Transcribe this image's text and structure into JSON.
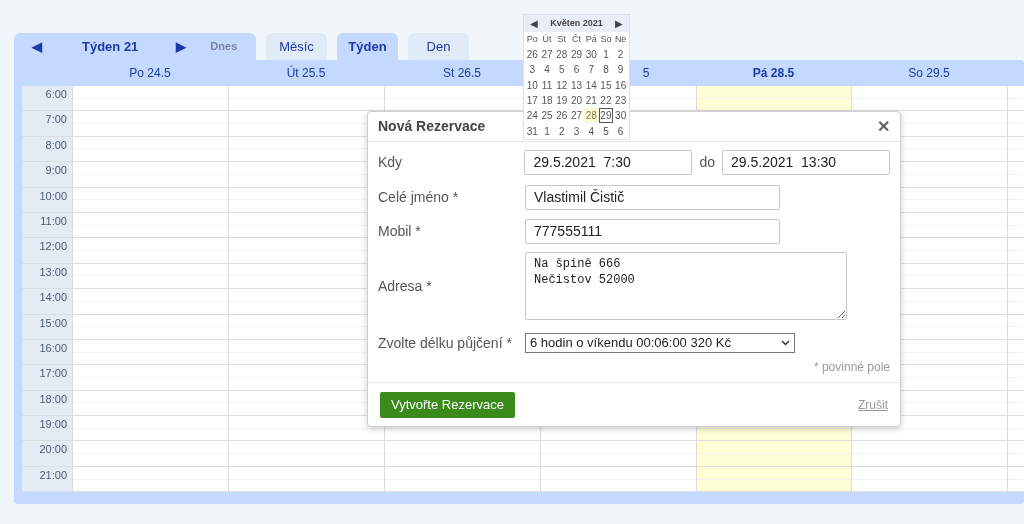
{
  "navigator": {
    "prev_arrow": "◀",
    "week_label": "Týden 21",
    "next_arrow": "▶",
    "today_button": {
      "label": "Dnes",
      "disabled": true
    }
  },
  "view_tabs": [
    {
      "label": "Měsíc",
      "selected": false
    },
    {
      "label": "Týden",
      "selected": true
    },
    {
      "label": "Den",
      "selected": false
    }
  ],
  "days": [
    {
      "label": "Po 24.5",
      "today": false
    },
    {
      "label": "Út 25.5",
      "today": false
    },
    {
      "label": "St 26.5",
      "today": false
    },
    {
      "label": "5",
      "today": false
    },
    {
      "label": "Pá 28.5",
      "today": true
    },
    {
      "label": "So 29.5",
      "today": false
    },
    {
      "today": false
    }
  ],
  "hours": [
    "6:00",
    "7:00",
    "8:00",
    "9:00",
    "10:00",
    "11:00",
    "12:00",
    "13:00",
    "14:00",
    "15:00",
    "16:00",
    "17:00",
    "18:00",
    "19:00",
    "20:00",
    "21:00"
  ],
  "dialog": {
    "title": "Nová Rezervace",
    "close": "✕",
    "when": {
      "label": "Kdy",
      "from": "29.5.2021  7:30",
      "separator": "do",
      "to": "29.5.2021  13:30"
    },
    "name": {
      "label": "Celé jméno *",
      "value": "Vlastimil Čistič"
    },
    "mobile": {
      "label": "Mobil *",
      "value": "777555111"
    },
    "address": {
      "label": "Adresa *",
      "value": "Na špině 666\nNečistov 52000"
    },
    "duration": {
      "label": "Zvolte délku půjčení *",
      "value": "6 hodin o víkendu 00:06:00 320 Kč"
    },
    "required_note": "* povinné pole",
    "submit": "Vytvořte Rezervace",
    "cancel": "Zrušit"
  },
  "mini_calendar": {
    "prev_arrow": "◀",
    "title": "Květen 2021",
    "next_arrow": "▶",
    "weekdays": [
      "Po",
      "Út",
      "St",
      "Čt",
      "Pá",
      "So",
      "Ne"
    ],
    "weeks": [
      [
        {
          "label": "26",
          "today": false,
          "selected": false
        },
        {
          "label": "27",
          "today": false,
          "selected": false
        },
        {
          "label": "28",
          "today": false,
          "selected": false
        },
        {
          "label": "29",
          "today": false,
          "selected": false
        },
        {
          "label": "30",
          "today": false,
          "selected": false
        },
        {
          "label": "1",
          "today": false,
          "selected": false
        },
        {
          "label": "2",
          "today": false,
          "selected": false
        }
      ],
      [
        {
          "label": "3",
          "today": false,
          "selected": false
        },
        {
          "label": "4",
          "today": false,
          "selected": false
        },
        {
          "label": "5",
          "today": false,
          "selected": false
        },
        {
          "label": "6",
          "today": false,
          "selected": false
        },
        {
          "label": "7",
          "today": false,
          "selected": false
        },
        {
          "label": "8",
          "today": false,
          "selected": false
        },
        {
          "label": "9",
          "today": false,
          "selected": false
        }
      ],
      [
        {
          "label": "10",
          "today": false,
          "selected": false
        },
        {
          "label": "11",
          "today": false,
          "selected": false
        },
        {
          "label": "12",
          "today": false,
          "selected": false
        },
        {
          "label": "13",
          "today": false,
          "selected": false
        },
        {
          "label": "14",
          "today": false,
          "selected": false
        },
        {
          "label": "15",
          "today": false,
          "selected": false
        },
        {
          "label": "16",
          "today": false,
          "selected": false
        }
      ],
      [
        {
          "label": "17",
          "today": false,
          "selected": false
        },
        {
          "label": "18",
          "today": false,
          "selected": false
        },
        {
          "label": "19",
          "today": false,
          "selected": false
        },
        {
          "label": "20",
          "today": false,
          "selected": false
        },
        {
          "label": "21",
          "today": false,
          "selected": false
        },
        {
          "label": "22",
          "today": false,
          "selected": false
        },
        {
          "label": "23",
          "today": false,
          "selected": false
        }
      ],
      [
        {
          "label": "24",
          "today": false,
          "selected": false
        },
        {
          "label": "25",
          "today": false,
          "selected": false
        },
        {
          "label": "26",
          "today": false,
          "selected": false
        },
        {
          "label": "27",
          "today": false,
          "selected": false
        },
        {
          "label": "28",
          "today": true,
          "selected": false
        },
        {
          "label": "29",
          "today": false,
          "selected": true
        },
        {
          "label": "30",
          "today": false,
          "selected": false
        }
      ],
      [
        {
          "label": "31",
          "today": false,
          "selected": false
        },
        {
          "label": "1",
          "today": false,
          "selected": false
        },
        {
          "label": "2",
          "today": false,
          "selected": false
        },
        {
          "label": "3",
          "today": false,
          "selected": false
        },
        {
          "label": "4",
          "today": false,
          "selected": false
        },
        {
          "label": "5",
          "today": false,
          "selected": false
        },
        {
          "label": "6",
          "today": false,
          "selected": false
        }
      ]
    ]
  }
}
